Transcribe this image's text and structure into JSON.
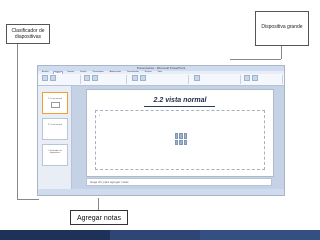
{
  "callouts": {
    "clasificador": "Clasificador  de diapositivas",
    "dispositiva_grande": "Dispositiva grande",
    "agregar_notas": "Agregar notas"
  },
  "window": {
    "title": "Presentación - Microsoft PowerPoint",
    "tabs": [
      "Archivo",
      "Inicio",
      "Insertar",
      "Diseño",
      "Transiciones",
      "Animaciones",
      "Presentación",
      "Revisar",
      "Vista"
    ],
    "active_tab": "Inicio"
  },
  "slide_panel": {
    "thumbnails": [
      {
        "text": "2.2 vista normal",
        "selected": true
      },
      {
        "text": "2.2 vista normal",
        "selected": false
      },
      {
        "text": "Clasificador de diapositivas",
        "selected": false
      }
    ]
  },
  "slide": {
    "title": "2.2 vista normal",
    "bullet": "•"
  },
  "notes": {
    "placeholder": "Haga clic para agregar notas"
  },
  "colors": {
    "bottom_bar": "#253a66",
    "accent_orange": "#f0a030"
  }
}
